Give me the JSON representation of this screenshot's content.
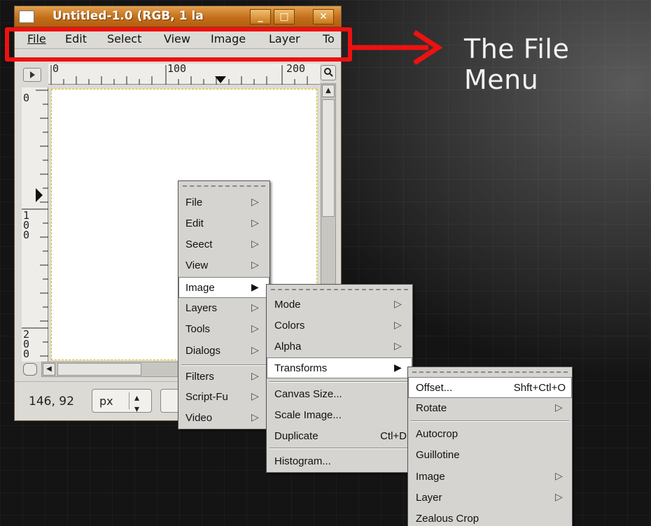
{
  "heading": "The File Menu",
  "window": {
    "title": "Untitled-1.0 (RGB, 1 la",
    "min_glyph": "_",
    "max_glyph": "□",
    "close_glyph": "✕",
    "menubar": [
      "File",
      "Edit",
      "Select",
      "View",
      "Image",
      "Layer",
      "To"
    ],
    "ruler_h_labels": [
      "0",
      "100",
      "200"
    ],
    "ruler_v_labels": [
      "0",
      "1\n0\n0",
      "2\n0\n0"
    ],
    "coords": "146, 92",
    "unit": "px"
  },
  "main_menu": [
    {
      "label": "File",
      "sub": true
    },
    {
      "label": "Edit",
      "sub": true
    },
    {
      "label": "Seect",
      "sub": true
    },
    {
      "label": "View",
      "sub": true
    },
    {
      "label": "Image",
      "sub": true
    },
    {
      "label": "Layers",
      "sub": true
    },
    {
      "label": "Tools",
      "sub": true
    },
    {
      "label": "Dialogs",
      "sub": true
    },
    {
      "label": "Filters",
      "sub": true
    },
    {
      "label": "Script-Fu",
      "sub": true
    },
    {
      "label": "Video",
      "sub": true
    }
  ],
  "image_menu": [
    {
      "label": "Mode",
      "sub": true
    },
    {
      "label": "Colors",
      "sub": true
    },
    {
      "label": "Alpha",
      "sub": true
    },
    {
      "label": "Transforms",
      "sub": true
    },
    {
      "label": "Canvas Size..."
    },
    {
      "label": "Scale Image..."
    },
    {
      "label": "Duplicate",
      "shortcut": "Ctl+D"
    },
    {
      "label": "Histogram..."
    }
  ],
  "transforms_menu": [
    {
      "label": "Offset...",
      "shortcut": "Shft+Ctl+O"
    },
    {
      "label": "Rotate",
      "sub": true
    },
    {
      "label": "Autocrop"
    },
    {
      "label": "Guillotine"
    },
    {
      "label": "Image",
      "sub": true
    },
    {
      "label": "Layer",
      "sub": true
    },
    {
      "label": "Zealous Crop"
    }
  ],
  "colors": {
    "highlight": "#ee1111",
    "titlebar": "#c46e1a"
  }
}
